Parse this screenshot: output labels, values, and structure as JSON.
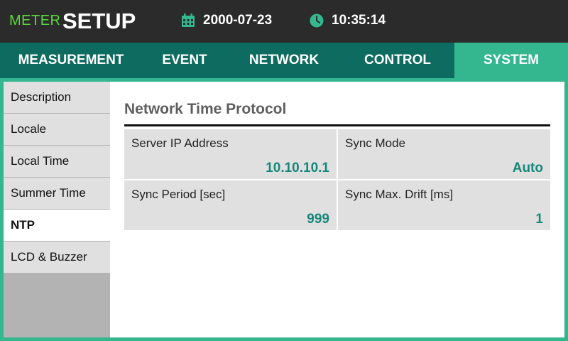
{
  "header": {
    "brand_prefix": "METER",
    "brand_title": "SETUP",
    "date": "2000-07-23",
    "time": "10:35:14",
    "calendar_icon": "calendar-icon",
    "clock_icon": "clock-icon"
  },
  "tabs": [
    {
      "label": "MEASUREMENT"
    },
    {
      "label": "EVENT"
    },
    {
      "label": "NETWORK"
    },
    {
      "label": "CONTROL"
    },
    {
      "label": "SYSTEM",
      "active": true
    }
  ],
  "sidebar": {
    "items": [
      {
        "label": "Description"
      },
      {
        "label": "Locale"
      },
      {
        "label": "Local Time"
      },
      {
        "label": "Summer Time"
      },
      {
        "label": "NTP",
        "active": true
      },
      {
        "label": "LCD & Buzzer"
      }
    ]
  },
  "main": {
    "title": "Network Time Protocol",
    "fields": [
      {
        "label": "Server IP Address",
        "value": "10.10.10.1"
      },
      {
        "label": "Sync Mode",
        "value": "Auto"
      },
      {
        "label": "Sync Period [sec]",
        "value": "999"
      },
      {
        "label": "Sync Max. Drift [ms]",
        "value": "1"
      }
    ]
  },
  "colors": {
    "accent": "#34b68e",
    "tab_bar": "#0e6b5f",
    "value_text": "#15877a",
    "brand_green": "#5ad73a",
    "header_bg": "#2b2b2b"
  }
}
